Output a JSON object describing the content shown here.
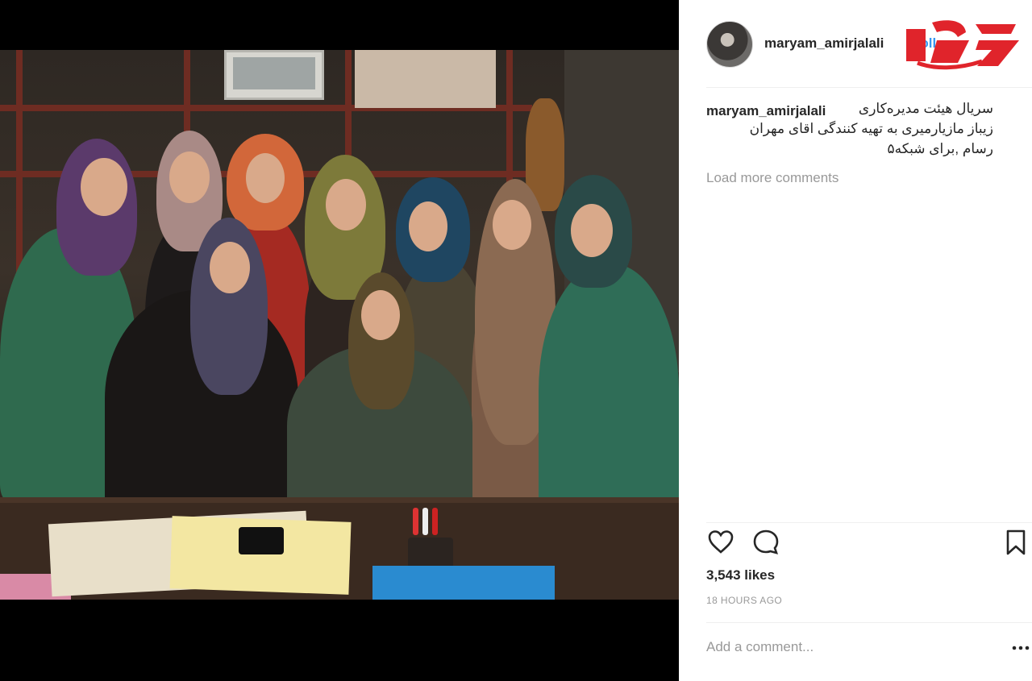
{
  "post": {
    "username": "maryam_amirjalali",
    "follow_label": "Follow",
    "caption_username": "maryam_amirjalali",
    "caption_lines": [
      "سریال هیئت مدیره‌کاری",
      "زیباز مازیارمیری به تهیه کنندگی اقای مهران",
      "رسام ,برای شبکه۵"
    ],
    "load_more_label": "Load more comments",
    "likes_text": "3,543 likes",
    "timestamp": "18 HOURS AGO",
    "comment_placeholder": "Add a comment..."
  },
  "icons": {
    "like": "heart-icon",
    "comment": "comment-icon",
    "save": "bookmark-icon",
    "more": "ellipsis-icon"
  },
  "colors": {
    "follow": "#3897f0",
    "logo_red": "#e0242b",
    "text": "#262626",
    "muted": "#999999"
  }
}
